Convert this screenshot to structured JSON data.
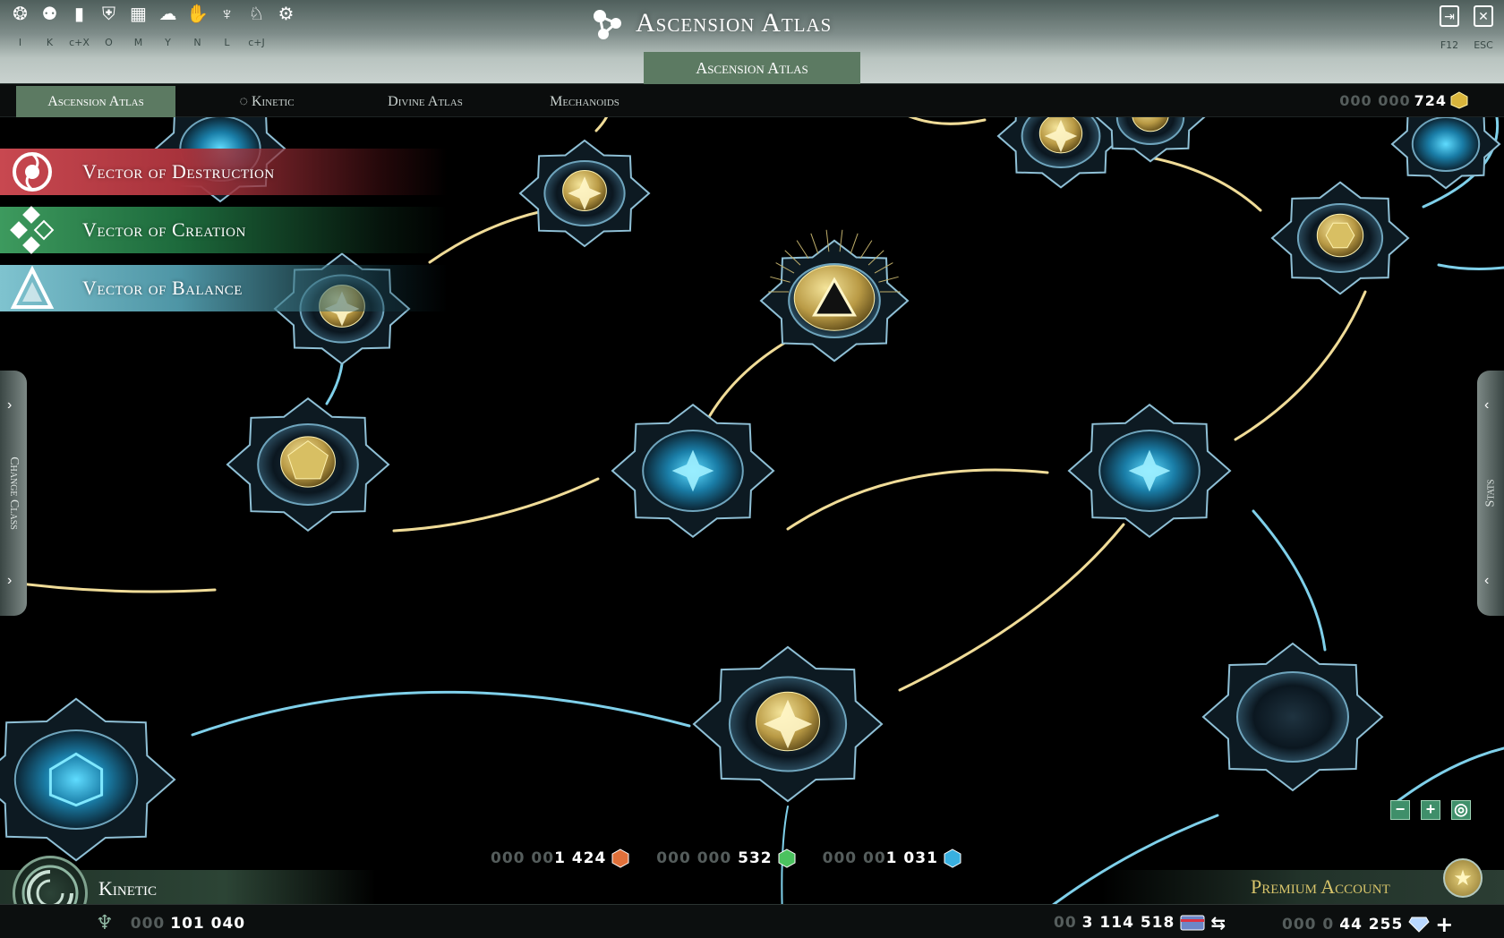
{
  "toolbar": {
    "icons": [
      {
        "name": "alert-icon",
        "glyph": "❂",
        "key": "I"
      },
      {
        "name": "ascension-icon",
        "glyph": "⚉",
        "key": "K"
      },
      {
        "name": "stats-chart-icon",
        "glyph": "▮",
        "key": "c+X"
      },
      {
        "name": "shield-icon",
        "glyph": "⛨",
        "key": "O"
      },
      {
        "name": "map-icon",
        "glyph": "▦",
        "key": "M"
      },
      {
        "name": "chat-icon",
        "glyph": "☁",
        "key": "Y"
      },
      {
        "name": "handshake-icon",
        "glyph": "✋",
        "key": "N"
      },
      {
        "name": "guild-icon",
        "glyph": "♆",
        "key": "L"
      },
      {
        "name": "pet-icon",
        "glyph": "♘",
        "key": "c+J"
      },
      {
        "name": "settings-gear-icon",
        "glyph": "⚙",
        "key": ""
      }
    ],
    "title": "Ascension Atlas",
    "subtab": "Ascension Atlas",
    "controls": [
      {
        "name": "exit-icon",
        "glyph": "⇥",
        "key": "F12"
      },
      {
        "name": "close-icon",
        "glyph": "✕",
        "key": "ESC"
      }
    ]
  },
  "tabs": [
    {
      "label": "Ascension Atlas",
      "active": true
    },
    {
      "label": "Kinetic",
      "active": false
    },
    {
      "label": "Divine Atlas",
      "active": false
    },
    {
      "label": "Mechanoids",
      "active": false
    }
  ],
  "top_currency": {
    "dim": "000 000 ",
    "value": "724"
  },
  "vectors": [
    {
      "label": "Vector of Destruction",
      "icon": "destruction-vortex-icon"
    },
    {
      "label": "Vector of Creation",
      "icon": "creation-diamonds-icon"
    },
    {
      "label": "Vector of Balance",
      "icon": "balance-triangle-icon"
    }
  ],
  "side": {
    "left": "Change Class",
    "right": "Stats"
  },
  "zoom": {
    "minus": "−",
    "plus": "+",
    "center": "◎"
  },
  "resources": [
    {
      "dim": "000 00",
      "value": "1 424",
      "color": "#e0703a"
    },
    {
      "dim": "000 000 ",
      "value": "532",
      "color": "#4bc25f"
    },
    {
      "dim": "000 00",
      "value": "1 031",
      "color": "#39b0e0"
    }
  ],
  "bottom": {
    "class_name": "Kinetic",
    "level_dim": "000 ",
    "level_value": "101 040",
    "premium": "Premium Account",
    "credits_dim": "00",
    "credits_value": "3 114 518",
    "gems_dim": "000 0",
    "gems_value": "44 255"
  }
}
